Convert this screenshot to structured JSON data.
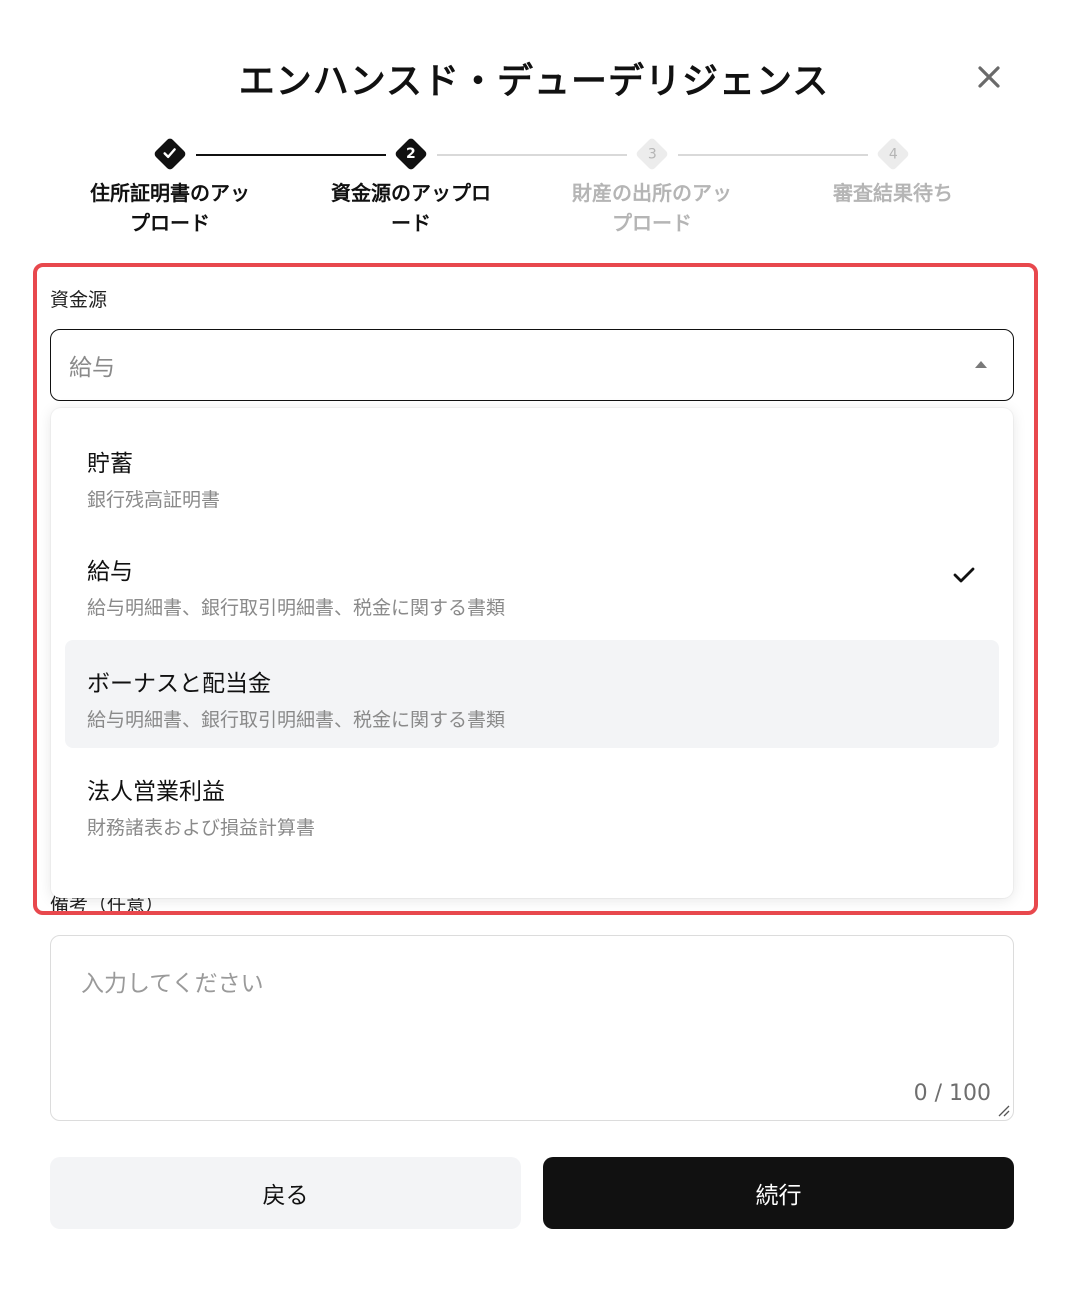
{
  "modal": {
    "title": "エンハンスド・デューデリジェンス"
  },
  "stepper": {
    "steps": [
      {
        "label_line1": "住所証明書のアッ",
        "label_line2": "プロード",
        "status": "completed",
        "number": ""
      },
      {
        "label_line1": "資金源のアップロ",
        "label_line2": "ード",
        "status": "active",
        "number": "2"
      },
      {
        "label_line1": "財産の出所のアッ",
        "label_line2": "プロード",
        "status": "pending",
        "number": "3"
      },
      {
        "label_line1": "審査結果待ち",
        "label_line2": "",
        "status": "pending",
        "number": "4"
      }
    ]
  },
  "source_of_funds": {
    "label": "資金源",
    "selected_value": "給与",
    "options": [
      {
        "title": "貯蓄",
        "desc": "銀行残高証明書"
      },
      {
        "title": "給与",
        "desc": "給与明細書、銀行取引明細書、税金に関する書類"
      },
      {
        "title": "ボーナスと配当金",
        "desc": "給与明細書、銀行取引明細書、税金に関する書類"
      },
      {
        "title": "法人営業利益",
        "desc": "財務諸表および損益計算書"
      }
    ]
  },
  "notes": {
    "label": "備考（任意）",
    "placeholder": "入力してください",
    "counter": "0 / 100"
  },
  "footer": {
    "back_label": "戻る",
    "continue_label": "続行"
  },
  "colors": {
    "accent": "#111111",
    "highlight": "#e8484d",
    "muted": "#8a8a8a",
    "pending": "#cccccc",
    "hover_bg": "#f3f4f6"
  }
}
